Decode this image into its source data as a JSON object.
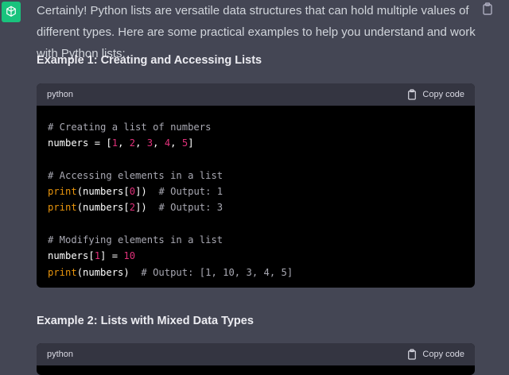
{
  "message": {
    "intro": "Certainly! Python lists are versatile data structures that can hold multiple values of different types. Here are some practical examples to help you understand and work with Python lists:",
    "heading_1": "Example 1: Creating and Accessing Lists",
    "heading_2": "Example 2: Lists with Mixed Data Types"
  },
  "code_blocks": [
    {
      "language": "python",
      "copy_label": "Copy code",
      "lines": [
        "# Creating a list of numbers",
        "numbers = [1, 2, 3, 4, 5]",
        "",
        "# Accessing elements in a list",
        "print(numbers[0])  # Output: 1",
        "print(numbers[2])  # Output: 3",
        "",
        "# Modifying elements in a list",
        "numbers[1] = 10",
        "print(numbers)  # Output: [1, 10, 3, 4, 5]"
      ]
    },
    {
      "language": "python",
      "copy_label": "Copy code",
      "lines": []
    }
  ],
  "colors": {
    "background": "#444654",
    "code_background": "#000000",
    "code_header": "#343541",
    "avatar": "#19c37d",
    "number": "#df3079",
    "function": "#e9950c",
    "comment": "#a9a9b3"
  },
  "icons": {
    "avatar": "openai-logo-icon",
    "copy_message": "clipboard-icon",
    "copy_code": "clipboard-icon"
  }
}
